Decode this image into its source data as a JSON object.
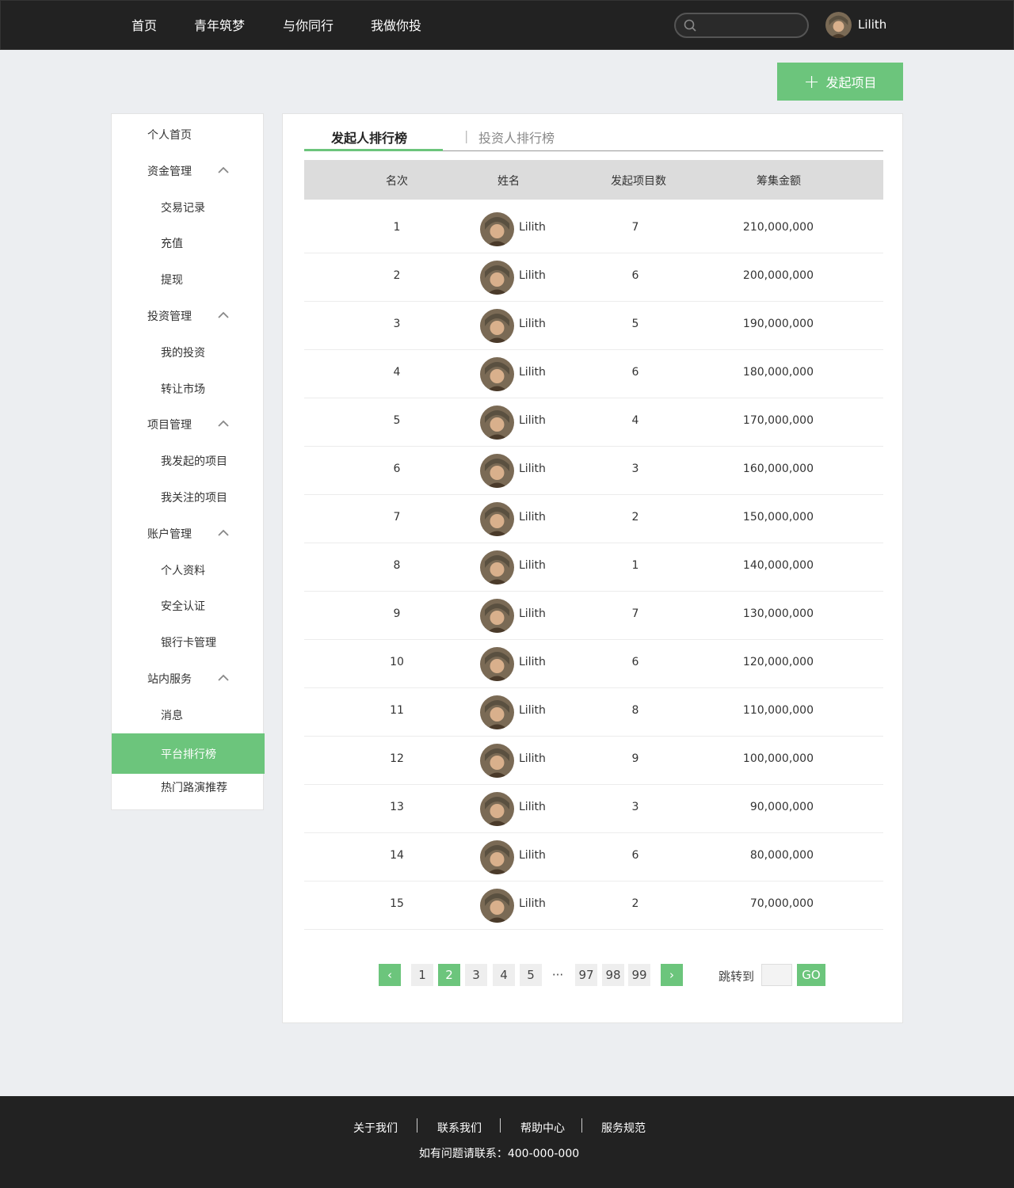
{
  "nav": {
    "items": [
      "首页",
      "青年筑梦",
      "与你同行",
      "我做你投"
    ],
    "search_placeholder": "",
    "user_name": "Lilith"
  },
  "launch_button": "发起项目",
  "sidebar": {
    "items": [
      {
        "label": "个人首页",
        "level": 1,
        "expandable": false
      },
      {
        "label": "资金管理",
        "level": 1,
        "expandable": true
      },
      {
        "label": "交易记录",
        "level": 2
      },
      {
        "label": "充值",
        "level": 2
      },
      {
        "label": "提现",
        "level": 2
      },
      {
        "label": "投资管理",
        "level": 1,
        "expandable": true
      },
      {
        "label": "我的投资",
        "level": 2
      },
      {
        "label": "转让市场",
        "level": 2
      },
      {
        "label": "项目管理",
        "level": 1,
        "expandable": true
      },
      {
        "label": "我发起的项目",
        "level": 2
      },
      {
        "label": "我关注的项目",
        "level": 2
      },
      {
        "label": "账户管理",
        "level": 1,
        "expandable": true
      },
      {
        "label": "个人资料",
        "level": 2
      },
      {
        "label": "安全认证",
        "level": 2
      },
      {
        "label": "银行卡管理",
        "level": 2
      },
      {
        "label": "站内服务",
        "level": 1,
        "expandable": true
      },
      {
        "label": "消息",
        "level": 2
      },
      {
        "label": "平台排行榜",
        "level": 2,
        "active": true
      },
      {
        "label": "热门路演推荐",
        "level": 2
      }
    ]
  },
  "tabs": {
    "active": "发起人排行榜",
    "separator": "|",
    "inactive": "投资人排行榜"
  },
  "table": {
    "headers": [
      "名次",
      "姓名",
      "发起项目数",
      "筹集金额"
    ],
    "rows": [
      {
        "rank": "1",
        "name": "Lilith",
        "count": "7",
        "amount": "210,000,000"
      },
      {
        "rank": "2",
        "name": "Lilith",
        "count": "6",
        "amount": "200,000,000"
      },
      {
        "rank": "3",
        "name": "Lilith",
        "count": "5",
        "amount": "190,000,000"
      },
      {
        "rank": "4",
        "name": "Lilith",
        "count": "6",
        "amount": "180,000,000"
      },
      {
        "rank": "5",
        "name": "Lilith",
        "count": "4",
        "amount": "170,000,000"
      },
      {
        "rank": "6",
        "name": "Lilith",
        "count": "3",
        "amount": "160,000,000"
      },
      {
        "rank": "7",
        "name": "Lilith",
        "count": "2",
        "amount": "150,000,000"
      },
      {
        "rank": "8",
        "name": "Lilith",
        "count": "1",
        "amount": "140,000,000"
      },
      {
        "rank": "9",
        "name": "Lilith",
        "count": "7",
        "amount": "130,000,000"
      },
      {
        "rank": "10",
        "name": "Lilith",
        "count": "6",
        "amount": "120,000,000"
      },
      {
        "rank": "11",
        "name": "Lilith",
        "count": "8",
        "amount": "110,000,000"
      },
      {
        "rank": "12",
        "name": "Lilith",
        "count": "9",
        "amount": "100,000,000"
      },
      {
        "rank": "13",
        "name": "Lilith",
        "count": "3",
        "amount": "90,000,000"
      },
      {
        "rank": "14",
        "name": "Lilith",
        "count": "6",
        "amount": "80,000,000"
      },
      {
        "rank": "15",
        "name": "Lilith",
        "count": "2",
        "amount": "70,000,000"
      }
    ]
  },
  "pagination": {
    "prev": "‹",
    "pages": [
      "1",
      "2",
      "3",
      "4",
      "5",
      "···",
      "97",
      "98",
      "99"
    ],
    "current": "2",
    "next": "›",
    "jump_label": "跳转到",
    "jump_value": "",
    "go": "GO"
  },
  "footer": {
    "links": [
      "关于我们",
      "联系我们",
      "帮助中心",
      "服务规范"
    ],
    "contact": "如有问题请联系：400-000-000"
  },
  "colors": {
    "accent": "#6cc57c",
    "topbar": "#222222",
    "background": "#eceef1"
  }
}
